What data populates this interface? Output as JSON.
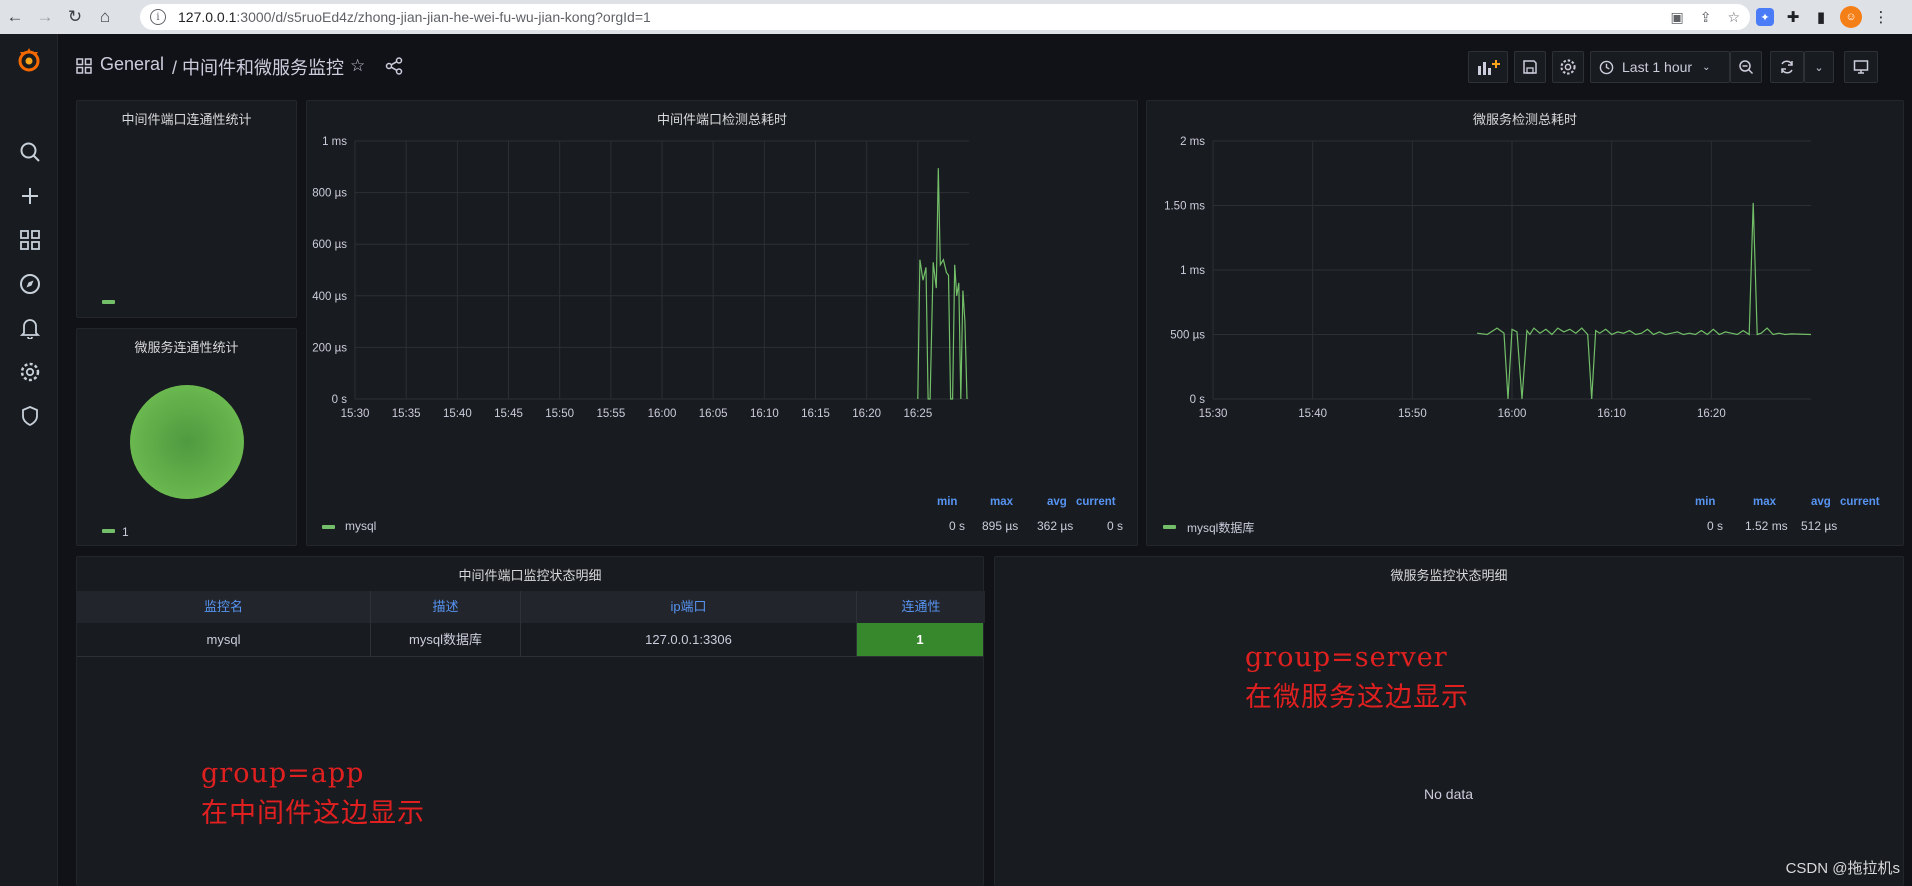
{
  "browser": {
    "url_host": "127.0.0.1",
    "url_rest": ":3000/d/s5ruoEd4z/zhong-jian-jian-he-wei-fu-wu-jian-kong?orgId=1"
  },
  "header": {
    "folder": "General",
    "title": "/ 中间件和微服务监控",
    "time_range": "Last 1 hour"
  },
  "panels": {
    "mw_conn_stat": {
      "title": "中间件端口连通性统计",
      "legend": ""
    },
    "ms_conn_stat": {
      "title": "微服务连通性统计",
      "legend": "1",
      "value": 1
    },
    "mw_latency": {
      "title": "中间件端口检测总耗时",
      "series_name": "mysql",
      "stat_headers": [
        "min",
        "max",
        "avg",
        "current"
      ],
      "stat_values": [
        "0 s",
        "895 µs",
        "362 µs",
        "0 s"
      ]
    },
    "ms_latency": {
      "title": "微服务检测总耗时",
      "series_name": "mysql数据库",
      "stat_headers": [
        "min",
        "max",
        "avg",
        "current"
      ],
      "stat_values": [
        "0 s",
        "1.52 ms",
        "512 µs"
      ]
    },
    "mw_table": {
      "title": "中间件端口监控状态明细",
      "columns": [
        "监控名",
        "描述",
        "ip端口",
        "连通性"
      ],
      "rows": [
        [
          "mysql",
          "mysql数据库",
          "127.0.0.1:3306",
          "1"
        ]
      ]
    },
    "ms_table": {
      "title": "微服务监控状态明细",
      "empty_text": "No data"
    }
  },
  "annotations": {
    "app_line1": "group=app",
    "app_line2": "在中间件这边显示",
    "server_line1": "group=server",
    "server_line2": "在微服务这边显示"
  },
  "watermark": "CSDN @拖拉机s",
  "chart_data": [
    {
      "type": "line",
      "title": "中间件端口检测总耗时",
      "x_ticks": [
        "15:30",
        "15:35",
        "15:40",
        "15:45",
        "15:50",
        "15:55",
        "16:00",
        "16:05",
        "16:10",
        "16:15",
        "16:20",
        "16:25"
      ],
      "y_ticks": [
        "0 s",
        "200 µs",
        "400 µs",
        "600 µs",
        "800 µs",
        "1 ms"
      ],
      "xlim": [
        0,
        60
      ],
      "ylim": [
        0,
        1000
      ],
      "y_unit": "µs",
      "series": [
        {
          "name": "mysql",
          "color": "#73bf69",
          "x": [
            55.0,
            55.2,
            55.5,
            55.8,
            56.0,
            56.2,
            56.5,
            56.8,
            57.0,
            57.2,
            57.5,
            57.8,
            58.0,
            58.2,
            58.4,
            58.6,
            58.8,
            59.0,
            59.2,
            59.4,
            59.6,
            59.8
          ],
          "y": [
            0,
            540,
            460,
            510,
            0,
            0,
            530,
            430,
            895,
            520,
            540,
            490,
            480,
            0,
            0,
            520,
            400,
            450,
            0,
            420,
            300,
            0
          ]
        }
      ]
    },
    {
      "type": "line",
      "title": "微服务检测总耗时",
      "x_ticks": [
        "15:30",
        "15:40",
        "15:50",
        "16:00",
        "16:10",
        "16:20"
      ],
      "y_ticks": [
        "0 s",
        "500 µs",
        "1 ms",
        "1.50 ms",
        "2 ms"
      ],
      "xlim": [
        0,
        60
      ],
      "ylim": [
        0,
        2000
      ],
      "y_unit": "µs",
      "series": [
        {
          "name": "mysql数据库",
          "color": "#73bf69",
          "x": [
            26.5,
            27.5,
            28.5,
            29.2,
            29.6,
            30.0,
            30.5,
            31.0,
            31.5,
            31.8,
            32.2,
            32.8,
            33.4,
            34.0,
            34.6,
            35.2,
            35.8,
            36.4,
            37.0,
            37.6,
            38.0,
            38.4,
            38.8,
            39.4,
            40.0,
            40.6,
            41.2,
            41.8,
            42.4,
            43.0,
            43.6,
            44.2,
            44.8,
            45.4,
            46.0,
            46.6,
            47.2,
            47.8,
            48.4,
            49.0,
            49.6,
            50.2,
            50.8,
            51.4,
            52.0,
            52.6,
            53.2,
            53.8,
            54.2,
            54.6,
            55.0,
            55.6,
            56.2,
            56.8,
            57.4,
            58.0,
            60.0
          ],
          "y": [
            510,
            500,
            550,
            510,
            0,
            540,
            520,
            0,
            530,
            500,
            550,
            510,
            540,
            500,
            550,
            520,
            540,
            510,
            550,
            500,
            0,
            530,
            510,
            540,
            500,
            520,
            510,
            530,
            500,
            510,
            540,
            500,
            520,
            500,
            510,
            520,
            500,
            510,
            500,
            530,
            500,
            540,
            500,
            520,
            510,
            500,
            530,
            500,
            1520,
            500,
            510,
            550,
            500,
            510,
            500,
            505,
            500
          ]
        }
      ]
    }
  ]
}
